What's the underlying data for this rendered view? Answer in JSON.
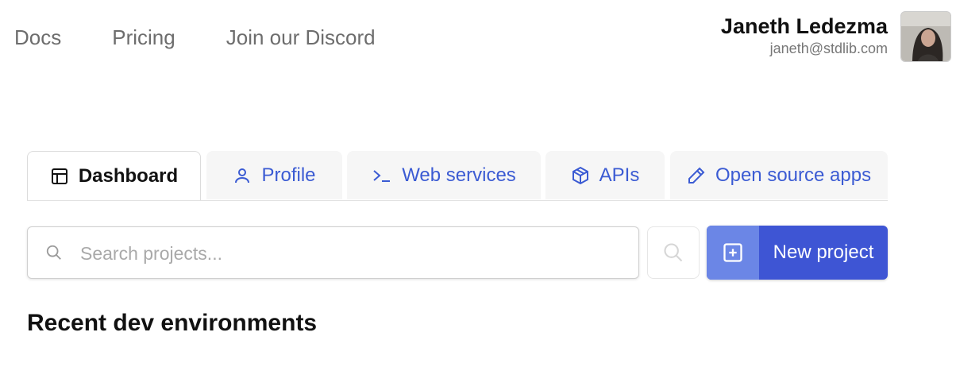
{
  "nav": {
    "items": [
      "Docs",
      "Pricing",
      "Join our Discord"
    ]
  },
  "user": {
    "name": "Janeth Ledezma",
    "email": "janeth@stdlib.com"
  },
  "tabs": [
    {
      "label": "Dashboard",
      "icon": "dashboard-icon",
      "active": true
    },
    {
      "label": "Profile",
      "icon": "user-icon"
    },
    {
      "label": "Web services",
      "icon": "terminal-icon"
    },
    {
      "label": "APIs",
      "icon": "package-icon"
    },
    {
      "label": "Open source apps",
      "icon": "pencil-icon"
    }
  ],
  "search": {
    "placeholder": "Search projects..."
  },
  "new_project": {
    "label": "New project"
  },
  "section": {
    "title": "Recent dev environments"
  },
  "colors": {
    "accent": "#3e55d4",
    "accent_light": "#6b86e6",
    "link": "#3b5bd3"
  }
}
